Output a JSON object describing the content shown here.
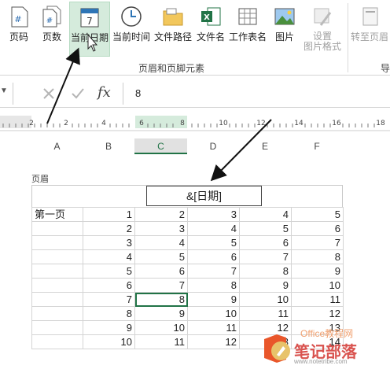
{
  "ribbon": {
    "buttons": [
      {
        "label": "页码",
        "icon": "page-number-icon"
      },
      {
        "label": "页数",
        "icon": "page-count-icon"
      },
      {
        "label": "当前日期",
        "icon": "current-date-icon"
      },
      {
        "label": "当前时间",
        "icon": "current-time-icon"
      },
      {
        "label": "文件路径",
        "icon": "file-path-icon"
      },
      {
        "label": "文件名",
        "icon": "file-name-icon"
      },
      {
        "label": "工作表名",
        "icon": "sheet-name-icon"
      },
      {
        "label": "图片",
        "icon": "picture-icon"
      },
      {
        "label": "设置\n图片格式",
        "icon": "format-picture-icon"
      },
      {
        "label": "转至页眉",
        "icon": "go-to-header-icon"
      },
      {
        "label": "导",
        "icon": ""
      }
    ],
    "group_label": "页眉和页脚元素",
    "date_icon_day": "7"
  },
  "formula_bar": {
    "fx": "fx",
    "value": "8"
  },
  "ruler": {
    "ticks": [
      "2",
      "2",
      "4",
      "6",
      "8",
      "10",
      "12",
      "14",
      "16",
      "18"
    ]
  },
  "columns": [
    "A",
    "B",
    "C",
    "D",
    "E",
    "F"
  ],
  "header_area": {
    "label": "页眉",
    "center": "&[日期]"
  },
  "rows": [
    [
      "第一页",
      "1",
      "2",
      "3",
      "4",
      "5"
    ],
    [
      "",
      "2",
      "3",
      "4",
      "5",
      "6"
    ],
    [
      "",
      "3",
      "4",
      "5",
      "6",
      "7"
    ],
    [
      "",
      "4",
      "5",
      "6",
      "7",
      "8"
    ],
    [
      "",
      "5",
      "6",
      "7",
      "8",
      "9"
    ],
    [
      "",
      "6",
      "7",
      "8",
      "9",
      "10"
    ],
    [
      "",
      "7",
      "8",
      "9",
      "10",
      "11"
    ],
    [
      "",
      "8",
      "9",
      "10",
      "11",
      "12"
    ],
    [
      "",
      "9",
      "10",
      "11",
      "12",
      "13"
    ],
    [
      "",
      "10",
      "11",
      "12",
      "13",
      "14"
    ]
  ],
  "watermark": {
    "text": "笔记部落",
    "url": "www.notetribe.com",
    "office": "Office教程网"
  }
}
